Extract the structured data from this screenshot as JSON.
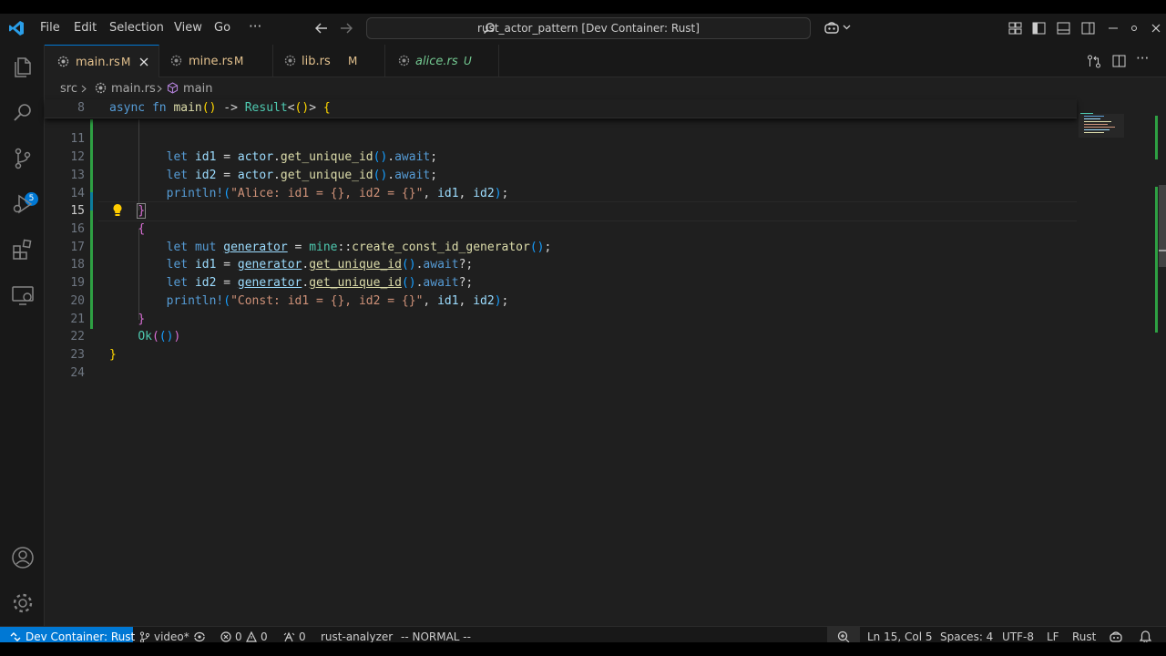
{
  "menu": [
    "File",
    "Edit",
    "Selection",
    "View",
    "Go"
  ],
  "menu_more": "···",
  "search": {
    "text": "rust_actor_pattern [Dev Container: Rust]"
  },
  "tabs": [
    {
      "name": "main.rs",
      "flag": "M",
      "active": true
    },
    {
      "name": "mine.rs",
      "flag": "M"
    },
    {
      "name": "lib.rs",
      "flag": "M"
    },
    {
      "name": "alice.rs",
      "flag": "U"
    }
  ],
  "breadcrumb": {
    "folder": "src",
    "file": "main.rs",
    "symbol": "main"
  },
  "activity_badge": "5",
  "editor": {
    "sticky_line": "8",
    "lines": [
      "11",
      "12",
      "13",
      "14",
      "15",
      "16",
      "17",
      "18",
      "19",
      "20",
      "21",
      "22",
      "23",
      "24"
    ],
    "current_line": "15"
  },
  "status": {
    "remote": "Dev Container: Rust",
    "branch": "video*",
    "errors": "0",
    "warnings": "0",
    "ports": "0",
    "analyzer": "rust-analyzer",
    "mode": "-- NORMAL --",
    "position": "Ln 15, Col 5",
    "spaces": "Spaces: 4",
    "encoding": "UTF-8",
    "eol": "LF",
    "language": "Rust"
  },
  "colors": {
    "accent": "#0078d4",
    "modified": "#e2c08d",
    "untracked": "#73c991",
    "gutter_added": "#2ea043"
  }
}
